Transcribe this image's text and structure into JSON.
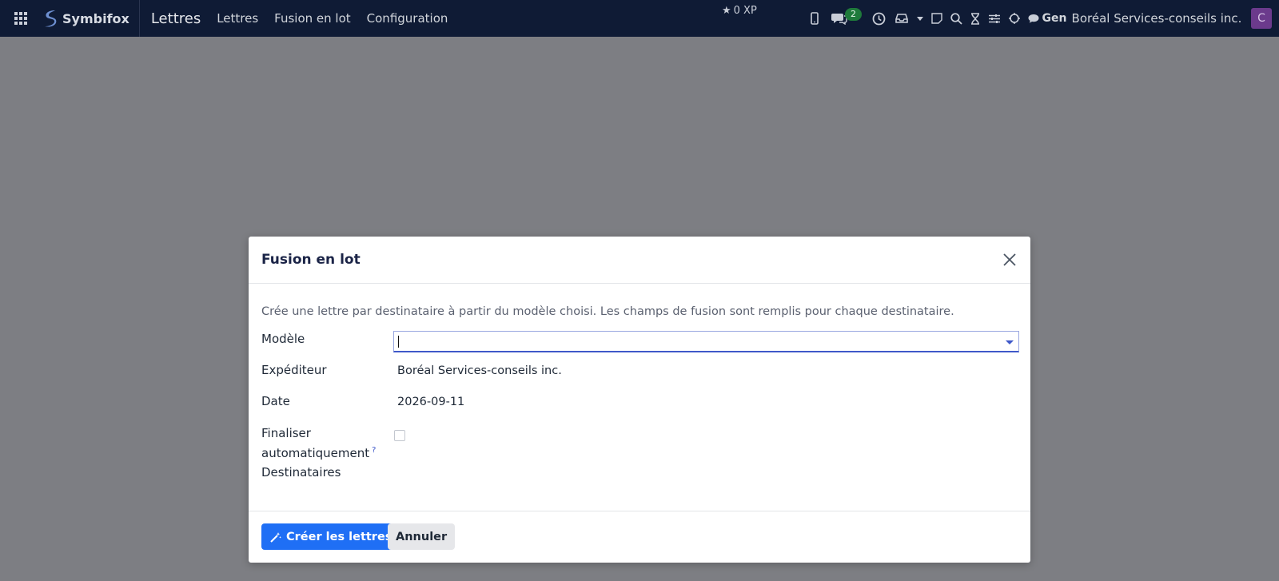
{
  "navbar": {
    "brand": "Symbifox",
    "app_title": "Lettres",
    "menu": [
      "Lettres",
      "Fusion en lot",
      "Configuration"
    ],
    "xp": "0 XP",
    "messages_count": "2",
    "user_short": "Gen",
    "company": "Boréal Services-conseils inc.",
    "avatar_initial": "C"
  },
  "modal": {
    "title": "Fusion en lot",
    "intro": "Crée une lettre par destinataire à partir du modèle choisi. Les champs de fusion sont remplis pour chaque destinataire.",
    "labels": {
      "model": "Modèle",
      "sender": "Expéditeur",
      "date": "Date",
      "auto_finalize_1": "Finaliser",
      "auto_finalize_2": "automatiquement",
      "help_mark": "?",
      "recipients": "Destinataires"
    },
    "values": {
      "model": "",
      "sender": "Boréal Services-conseils inc.",
      "date": "2026-09-11",
      "auto_finalize_checked": false
    },
    "buttons": {
      "create": "Créer les lettres",
      "cancel": "Annuler"
    }
  }
}
